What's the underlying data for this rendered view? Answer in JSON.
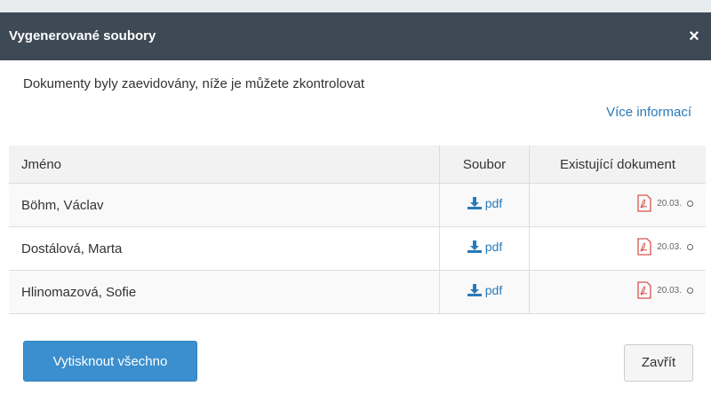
{
  "dialog": {
    "title": "Vygenerované soubory",
    "close_glyph": "×",
    "intro": "Dokumenty byly zaevidovány, níže je můžete zkontrolovat",
    "more_info": "Více informací"
  },
  "table": {
    "headers": {
      "name": "Jméno",
      "file": "Soubor",
      "existing": "Existující dokument"
    },
    "rows": [
      {
        "name": "Böhm, Václav",
        "file_label": "pdf",
        "date": "20.03."
      },
      {
        "name": "Dostálová, Marta",
        "file_label": "pdf",
        "date": "20.03."
      },
      {
        "name": "Hlinomazová, Sofie",
        "file_label": "pdf",
        "date": "20.03."
      }
    ]
  },
  "footer": {
    "print_all": "Vytisknout všechno",
    "close": "Zavřít"
  },
  "colors": {
    "header_bg": "#3d4a55",
    "primary": "#3b8fce",
    "link": "#2a7ab8",
    "pdf_red": "#d9534f"
  },
  "icons": [
    "close-icon",
    "download-icon",
    "pdf-file-icon",
    "circle-icon"
  ]
}
